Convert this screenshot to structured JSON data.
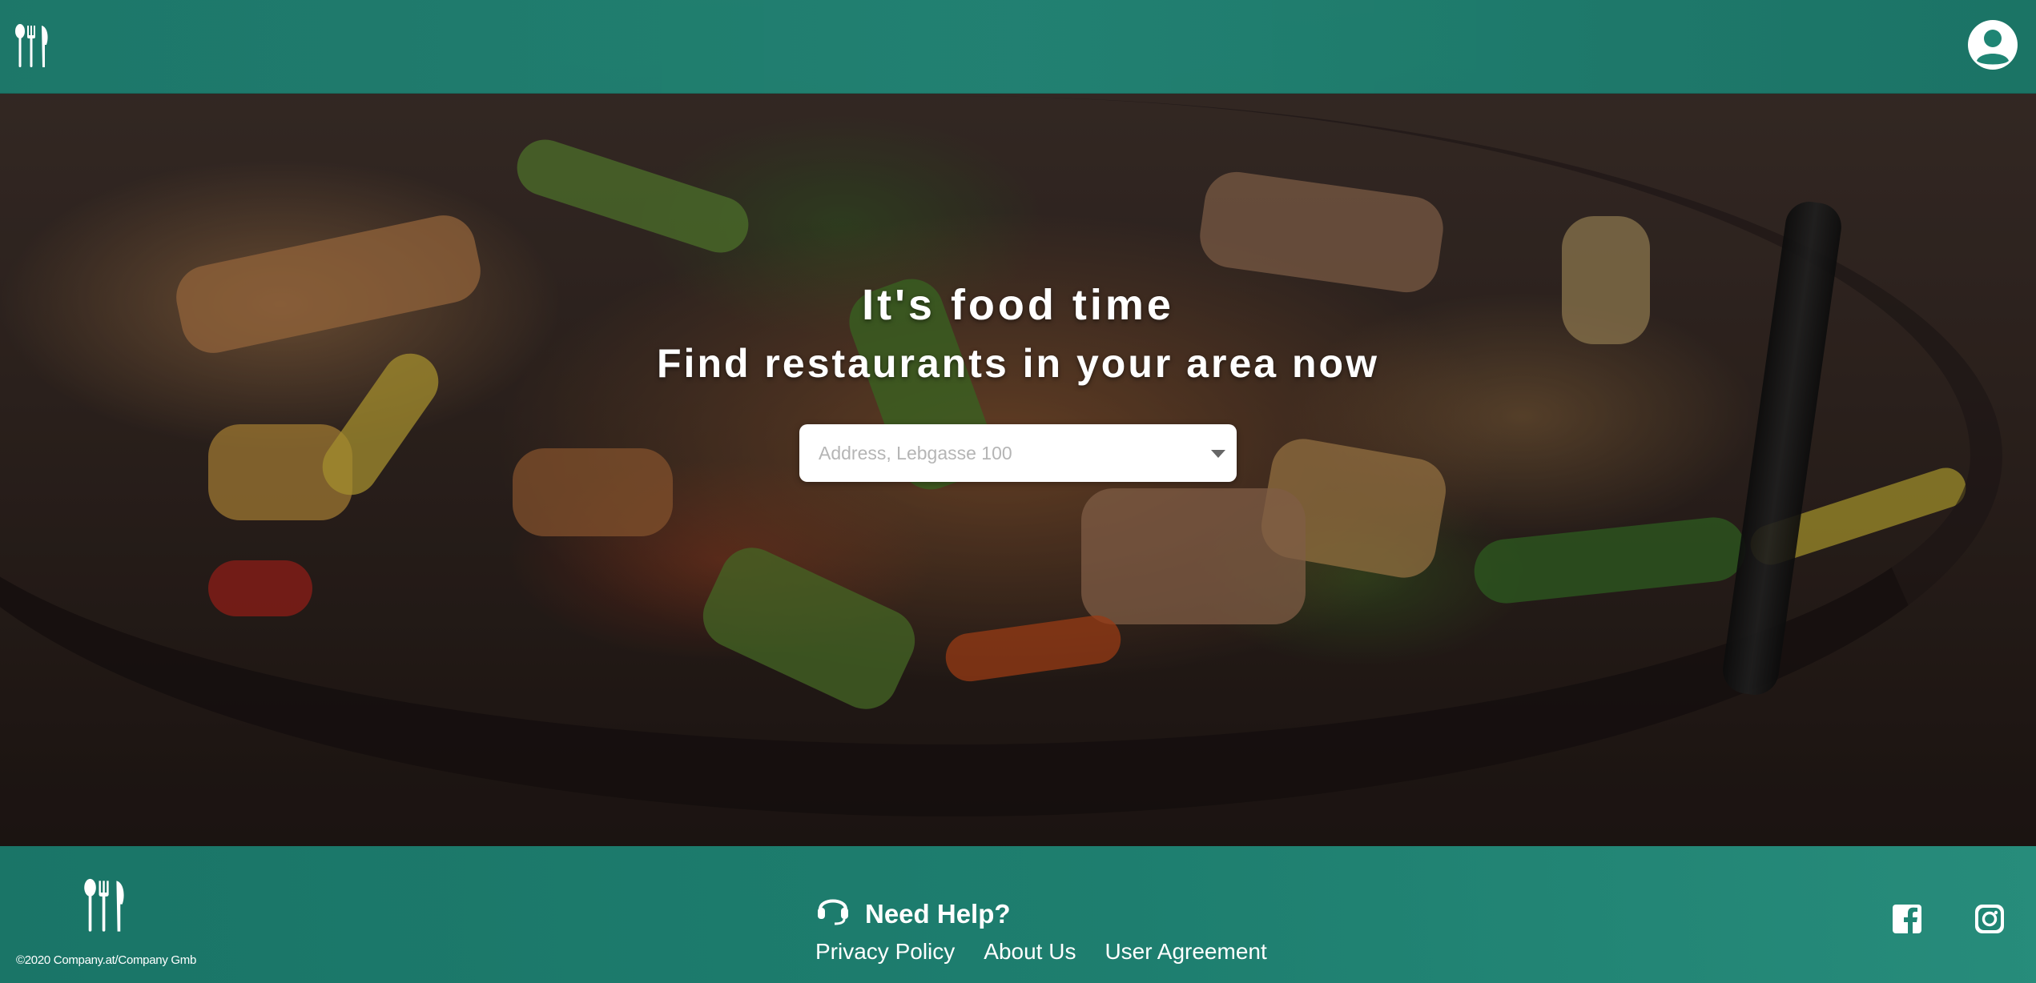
{
  "header": {
    "logo_icon": "fork-knife-spoon-icon",
    "account_icon": "user-circle-icon"
  },
  "hero": {
    "title": "It's food time",
    "subtitle": "Find restaurants in your area now",
    "search": {
      "placeholder": "Address, Lebgasse 100",
      "value": "",
      "dropdown_icon": "caret-down-icon"
    }
  },
  "footer": {
    "logo_icon": "fork-knife-spoon-icon",
    "copyright": "©2020 Company.at/Company Gmb",
    "help": {
      "icon": "headset-icon",
      "title": "Need Help?"
    },
    "links": [
      {
        "label": "Privacy Policy"
      },
      {
        "label": "About Us"
      },
      {
        "label": "User Agreement"
      }
    ],
    "social": [
      {
        "icon": "facebook-icon"
      },
      {
        "icon": "instagram-icon"
      }
    ]
  },
  "colors": {
    "brand_teal": "#1f8574",
    "text_white": "#ffffff",
    "placeholder_gray": "#b5b5b5"
  }
}
